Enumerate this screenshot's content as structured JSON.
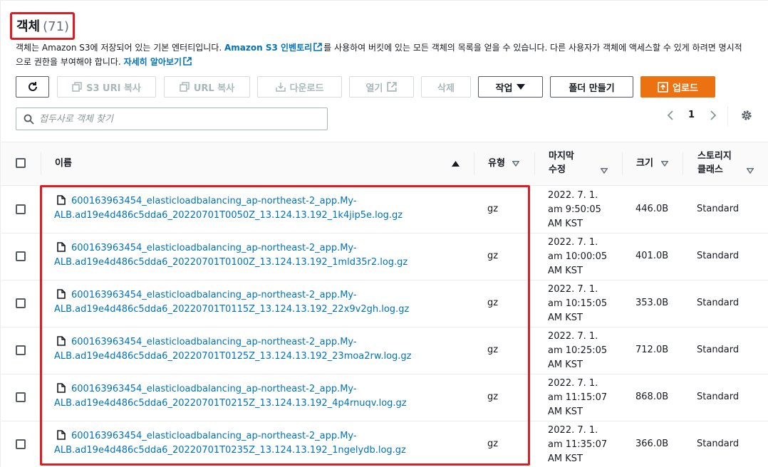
{
  "header": {
    "title": "객체",
    "count": "(71)"
  },
  "description": {
    "part1": "객체는 Amazon S3에 저장되어 있는 기본 엔터티입니다. ",
    "inventory_link": "Amazon S3 인벤토리",
    "part2": "를 사용하여 버킷에 있는 모든 객체의 목록을 얻을 수 있습니다. 다른 사용자가 객체에 액세스할 수 있게 하려면 명시적으로 권한을 부여해야 합니다. ",
    "learn_more_link": "자세히 알아보기"
  },
  "toolbar": {
    "refresh_icon": "refresh-icon",
    "copy_s3_uri": "S3 URI 복사",
    "copy_url": "URL 복사",
    "download": "다운로드",
    "open": "열기",
    "delete": "삭제",
    "actions": "작업",
    "create_folder": "폴더 만들기",
    "upload": "업로드"
  },
  "search": {
    "placeholder": "접두사로 객체 찾기"
  },
  "pagination": {
    "current_page": "1"
  },
  "table": {
    "columns": {
      "name": "이름",
      "type": "유형",
      "modified_line1": "마지막",
      "modified_line2": "수정",
      "size": "크기",
      "storage_line1": "스토리지",
      "storage_line2": "클래스"
    },
    "rows": [
      {
        "name_line1": "600163963454_elasticloadbalancing_ap-northeast-2_app.My-",
        "name_line2": "ALB.ad19e4d486c5dda6_20220701T0050Z_13.124.13.192_1k4jip5e.log.gz",
        "type": "gz",
        "date_line1": "2022. 7. 1.",
        "date_line2": "am 9:50:05",
        "date_line3": "AM KST",
        "size": "446.0B",
        "storage_class": "Standard"
      },
      {
        "name_line1": "600163963454_elasticloadbalancing_ap-northeast-2_app.My-",
        "name_line2": "ALB.ad19e4d486c5dda6_20220701T0100Z_13.124.13.192_1mld35r2.log.gz",
        "type": "gz",
        "date_line1": "2022. 7. 1.",
        "date_line2": "am 10:00:05",
        "date_line3": "AM KST",
        "size": "401.0B",
        "storage_class": "Standard"
      },
      {
        "name_line1": "600163963454_elasticloadbalancing_ap-northeast-2_app.My-",
        "name_line2": "ALB.ad19e4d486c5dda6_20220701T0115Z_13.124.13.192_22x9v2gh.log.gz",
        "type": "gz",
        "date_line1": "2022. 7. 1.",
        "date_line2": "am 10:15:05",
        "date_line3": "AM KST",
        "size": "353.0B",
        "storage_class": "Standard"
      },
      {
        "name_line1": "600163963454_elasticloadbalancing_ap-northeast-2_app.My-",
        "name_line2": "ALB.ad19e4d486c5dda6_20220701T0125Z_13.124.13.192_23moa2rw.log.gz",
        "type": "gz",
        "date_line1": "2022. 7. 1.",
        "date_line2": "am 10:25:05",
        "date_line3": "AM KST",
        "size": "712.0B",
        "storage_class": "Standard"
      },
      {
        "name_line1": "600163963454_elasticloadbalancing_ap-northeast-2_app.My-",
        "name_line2": "ALB.ad19e4d486c5dda6_20220701T0215Z_13.124.13.192_4p4rnuqv.log.gz",
        "type": "gz",
        "date_line1": "2022. 7. 1.",
        "date_line2": "am 11:15:07",
        "date_line3": "AM KST",
        "size": "868.0B",
        "storage_class": "Standard"
      },
      {
        "name_line1": "600163963454_elasticloadbalancing_ap-northeast-2_app.My-",
        "name_line2": "ALB.ad19e4d486c5dda6_20220701T0235Z_13.124.13.192_1ngelydb.log.gz",
        "type": "gz",
        "date_line1": "2022. 7. 1.",
        "date_line2": "am 11:35:07",
        "date_line3": "AM KST",
        "size": "366.0B",
        "storage_class": "Standard"
      }
    ]
  },
  "colors": {
    "accent_orange": "#ec7211",
    "link_blue": "#0073bb",
    "highlight_red": "#e11b22"
  }
}
